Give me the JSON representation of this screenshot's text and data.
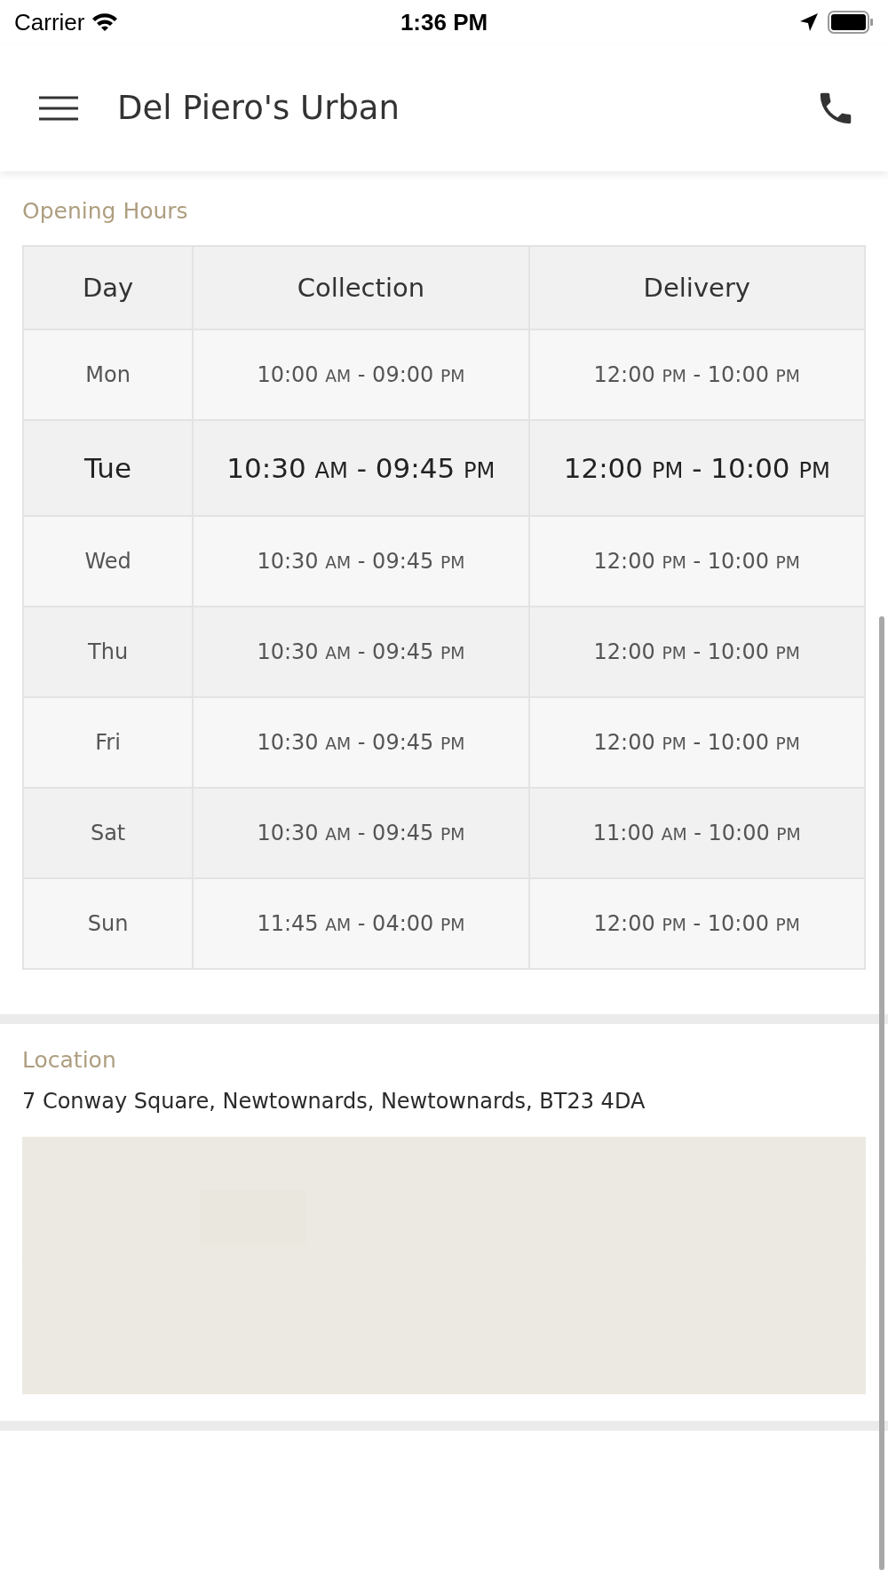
{
  "status_bar": {
    "carrier": "Carrier",
    "time": "1:36 PM"
  },
  "nav_bar": {
    "title": "Del Piero's Urban"
  },
  "opening_hours": {
    "heading": "Opening Hours",
    "columns": [
      "Day",
      "Collection",
      "Delivery"
    ],
    "rows": [
      {
        "day": "Mon",
        "collection": "10:00 AM - 09:00 PM",
        "delivery": "12:00 PM - 10:00 PM",
        "today": false
      },
      {
        "day": "Tue",
        "collection": "10:30 AM - 09:45 PM",
        "delivery": "12:00 PM - 10:00 PM",
        "today": true
      },
      {
        "day": "Wed",
        "collection": "10:30 AM - 09:45 PM",
        "delivery": "12:00 PM - 10:00 PM",
        "today": false
      },
      {
        "day": "Thu",
        "collection": "10:30 AM - 09:45 PM",
        "delivery": "12:00 PM - 10:00 PM",
        "today": false
      },
      {
        "day": "Fri",
        "collection": "10:30 AM - 09:45 PM",
        "delivery": "12:00 PM - 10:00 PM",
        "today": false
      },
      {
        "day": "Sat",
        "collection": "10:30 AM - 09:45 PM",
        "delivery": "11:00 AM - 10:00 PM",
        "today": false
      },
      {
        "day": "Sun",
        "collection": "11:45 AM - 04:00 PM",
        "delivery": "12:00 PM - 10:00 PM",
        "today": false
      }
    ]
  },
  "location": {
    "heading": "Location",
    "address": "7 Conway Square, Newtownards, Newtownards, BT23 4DA"
  }
}
